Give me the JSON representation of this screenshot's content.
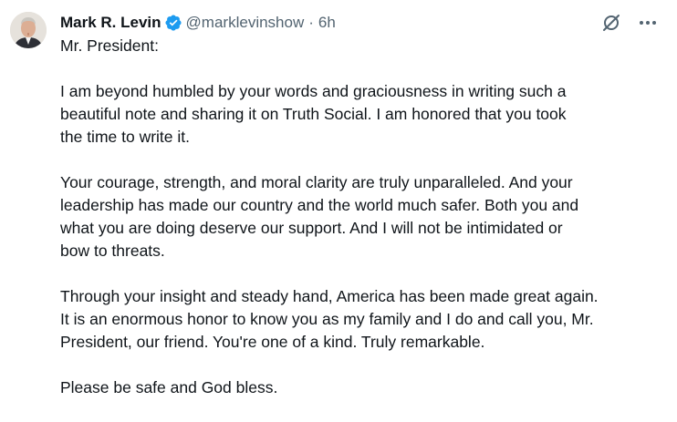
{
  "tweet": {
    "author": {
      "display_name": "Mark R. Levin",
      "handle": "@marklevinshow",
      "verified": true,
      "verified_color": "#1d9bf0",
      "avatar_icon": "profile-photo"
    },
    "separator": "·",
    "time": "6h",
    "actions": {
      "grok_icon": "grok-icon",
      "more_icon": "more-icon"
    },
    "body": {
      "salutation": "Mr. President:",
      "p1": [
        "I am beyond humbled by your words and graciousness in writing such a",
        "beautiful note and sharing it on Truth Social.  I am honored that you took",
        "the time to write it."
      ],
      "p2": [
        "Your courage, strength, and moral clarity are truly unparalleled.  And your",
        "leadership has made our country and the world much safer.  Both you and",
        "what you are doing deserve our support.  And I will not be intimidated or",
        "bow to threats."
      ],
      "p3": [
        "Through your insight and steady hand, America has been made great again.",
        "It is an enormous honor to know you as my family and I do and call you, Mr.",
        "President, our friend.  You're one of a kind.  Truly remarkable."
      ],
      "closing": "Please be safe and God bless."
    }
  }
}
